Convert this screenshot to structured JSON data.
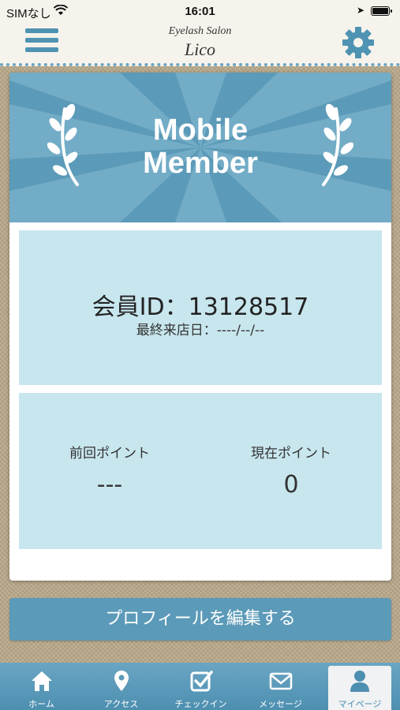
{
  "status_bar": {
    "carrier": "SIMなし",
    "time": "16:01"
  },
  "header": {
    "brand_sub": "Eyelash Salon",
    "brand_name": "Lico",
    "menu_icon": "hamburger-menu-icon",
    "settings_icon": "gear-icon"
  },
  "card": {
    "title_line1": "Mobile",
    "title_line2": "Member",
    "member_id": "会員ID：13128517",
    "last_visit": "最終来店日：----/--/--",
    "prev_points_label": "前回ポイント",
    "prev_points_value": "---",
    "current_points_label": "現在ポイント",
    "current_points_value": "0"
  },
  "edit_button": "プロフィールを編集する",
  "tabs": [
    {
      "label": "ホーム",
      "icon": "home-icon"
    },
    {
      "label": "アクセス",
      "icon": "map-pin-icon"
    },
    {
      "label": "チェックイン",
      "icon": "checkbox-icon"
    },
    {
      "label": "メッセージ",
      "icon": "envelope-icon"
    },
    {
      "label": "マイページ",
      "icon": "person-icon",
      "active": true
    }
  ],
  "colors": {
    "accent": "#5b9ab8",
    "panel": "#c8e6ee",
    "header_bg": "#f5f3ec"
  }
}
